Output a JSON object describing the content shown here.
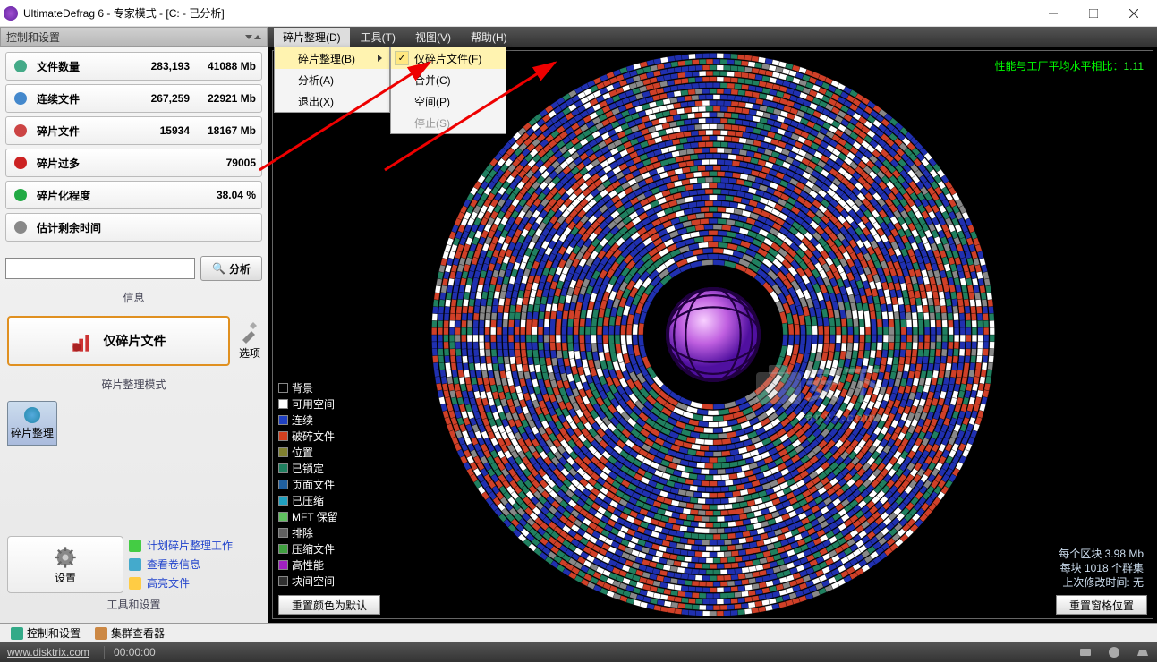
{
  "window": {
    "title": "UltimateDefrag 6 - 专家模式 - [C: - 已分析]"
  },
  "leftPanel": {
    "header": "控制和设置",
    "stats": [
      {
        "label": "文件数量",
        "v1": "283,193",
        "v2": "41088 Mb",
        "iconColor": "#4a8"
      },
      {
        "label": "连续文件",
        "v1": "267,259",
        "v2": "22921 Mb",
        "iconColor": "#48c"
      },
      {
        "label": "碎片文件",
        "v1": "15934",
        "v2": "18167 Mb",
        "iconColor": "#c44"
      },
      {
        "label": "碎片过多",
        "v1": "",
        "v2": "79005",
        "iconColor": "#c22"
      },
      {
        "label": "碎片化程度",
        "v1": "",
        "v2": "38.04 %",
        "iconColor": "#2a4"
      },
      {
        "label": "估计剩余时间",
        "v1": "",
        "v2": "",
        "iconColor": "#888"
      }
    ],
    "analyzeBtn": "分析",
    "infoLabel": "信息",
    "modeText": "仅碎片文件",
    "optionsLabel": "选项",
    "modeSection": "碎片整理模式",
    "tabBtn": "碎片整理",
    "settingsLabel": "设置",
    "links": [
      {
        "text": "计划碎片整理工作",
        "iconBg": "#4c4"
      },
      {
        "text": "查看卷信息",
        "iconBg": "#4ac"
      },
      {
        "text": "高亮文件",
        "iconBg": "#fc4"
      }
    ],
    "toolsSection": "工具和设置"
  },
  "menubar": {
    "items": [
      "碎片整理(D)",
      "工具(T)",
      "视图(V)",
      "帮助(H)"
    ]
  },
  "dropdown": {
    "items": [
      {
        "text": "碎片整理(B)",
        "hasArrow": true,
        "hl": true
      },
      {
        "text": "分析(A)"
      },
      {
        "text": "退出(X)"
      }
    ]
  },
  "submenu": {
    "items": [
      {
        "text": "仅碎片文件(F)",
        "checked": true,
        "hl": true
      },
      {
        "text": "合并(C)"
      },
      {
        "text": "空间(P)"
      },
      {
        "text": "停止(S)",
        "disabled": true
      }
    ]
  },
  "ratio": {
    "label": "性能与工厂平均水平相比：",
    "value": "1.11"
  },
  "legend": [
    {
      "text": "背景",
      "color": "#000000"
    },
    {
      "text": "可用空间",
      "color": "#ffffff"
    },
    {
      "text": "连续",
      "color": "#2040c0"
    },
    {
      "text": "破碎文件",
      "color": "#d04020"
    },
    {
      "text": "位置",
      "color": "#808030"
    },
    {
      "text": "已锁定",
      "color": "#208060"
    },
    {
      "text": "页面文件",
      "color": "#2060a0"
    },
    {
      "text": "已压缩",
      "color": "#20a0c0"
    },
    {
      "text": "MFT 保留",
      "color": "#60c060"
    },
    {
      "text": "排除",
      "color": "#606060"
    },
    {
      "text": "压缩文件",
      "color": "#40a040"
    },
    {
      "text": "高性能",
      "color": "#a020c0"
    },
    {
      "text": "块间空间",
      "color": "#303030"
    }
  ],
  "info": {
    "l1": "每个区块 3.98 Mb",
    "l2": "每块 1018 个群集",
    "l3": "上次修改时间:  无"
  },
  "bottomBtns": {
    "left": "重置颜色为默认",
    "right": "重置窗格位置"
  },
  "bottomTabs": [
    {
      "text": "控制和设置",
      "iconBg": "#3a8"
    },
    {
      "text": "集群查看器",
      "iconBg": "#c84"
    }
  ],
  "status": {
    "url": "www.disktrix.com",
    "time": "00:00:00"
  }
}
